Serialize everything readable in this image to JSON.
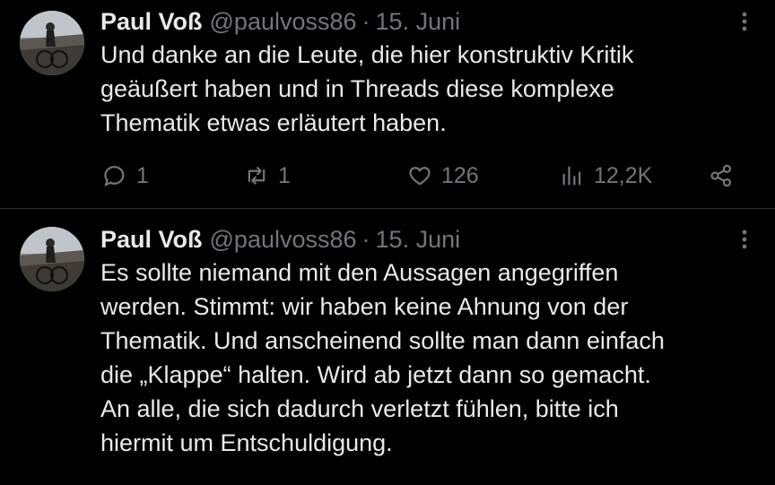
{
  "tweets": [
    {
      "author_name": "Paul Voß",
      "handle": "@paulvoss86",
      "separator": "·",
      "date": "15. Juni",
      "text_lines": [
        "Und danke an die Leute, die hier konstruktiv Kritik",
        "geäußert haben und in Threads diese komplexe",
        "Thematik etwas erläutert haben."
      ],
      "replies": "1",
      "reposts": "1",
      "likes": "126",
      "views": "12,2K"
    },
    {
      "author_name": "Paul Voß",
      "handle": "@paulvoss86",
      "separator": "·",
      "date": "15. Juni",
      "text_lines": [
        "Es sollte niemand mit den Aussagen angegriffen",
        "werden. Stimmt: wir haben keine Ahnung von der",
        "Thematik. Und anscheinend sollte man dann einfach",
        "die „Klappe“ halten. Wird ab jetzt dann so gemacht.",
        "An alle, die sich dadurch verletzt fühlen, bitte ich",
        "hiermit um Entschuldigung."
      ]
    }
  ],
  "icons": {
    "more": "more-vertical-icon",
    "reply": "reply-icon",
    "repost": "repost-icon",
    "like": "heart-icon",
    "views": "views-icon",
    "share": "share-icon"
  },
  "colors": {
    "background": "#000000",
    "text": "#e7e9ea",
    "secondary": "#71767b",
    "divider": "#2f3336"
  }
}
